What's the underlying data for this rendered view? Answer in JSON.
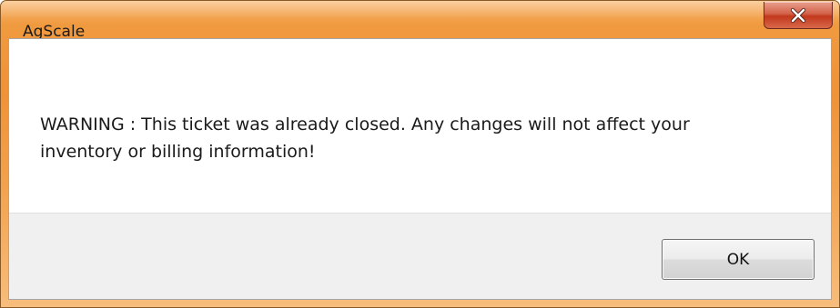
{
  "window": {
    "title": "AgScale"
  },
  "title_bar": {
    "close_icon": "close-icon"
  },
  "message": {
    "line1": "WARNING : This ticket was already closed. Any changes will not affect your",
    "line2": "inventory or billing information!"
  },
  "buttons": {
    "ok_label": "OK"
  },
  "colors": {
    "frame": "#ef9238",
    "close_button": "#c2381d",
    "button_area": "#f0f0f0"
  }
}
